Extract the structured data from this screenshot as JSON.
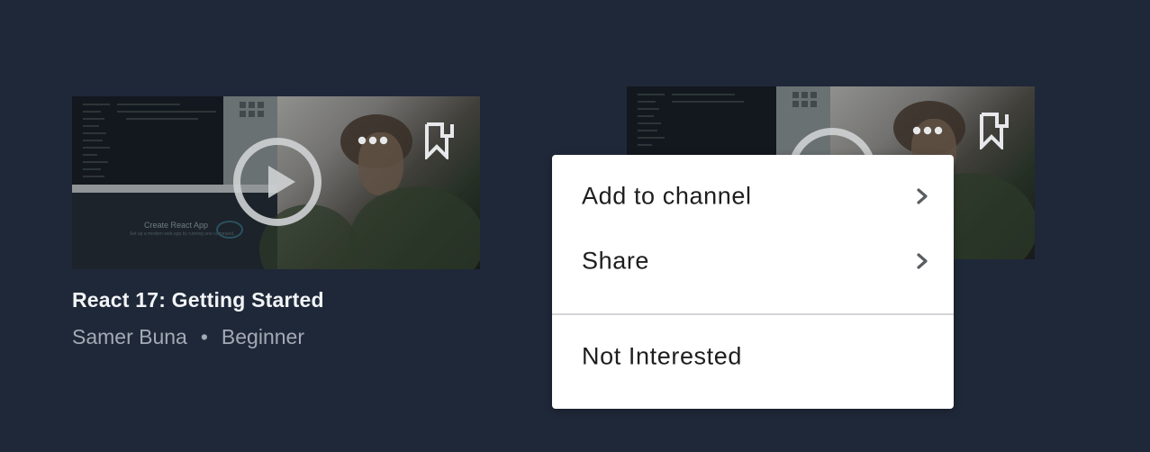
{
  "card": {
    "title": "React 17: Getting Started",
    "author": "Samer Buna",
    "separator": "•",
    "level": "Beginner",
    "thumbnail_caption": "Create React App",
    "thumbnail_subcaption": "Set up a modern web app by running one command."
  },
  "icons": {
    "play": "play-circle-icon",
    "more": "more-horizontal-icon",
    "bookmark": "bookmark-icon",
    "chevron": "chevron-right-icon"
  },
  "menu": {
    "items": [
      {
        "label": "Add to channel",
        "has_submenu": true
      },
      {
        "label": "Share",
        "has_submenu": true
      },
      {
        "label": "Not Interested",
        "has_submenu": false
      }
    ]
  },
  "colors": {
    "background": "#1f2839",
    "title_text": "#f2f4f6",
    "meta_text": "#a3aab5",
    "menu_background": "#ffffff",
    "menu_text": "#1e1e1e",
    "divider": "#d3d5d8"
  }
}
